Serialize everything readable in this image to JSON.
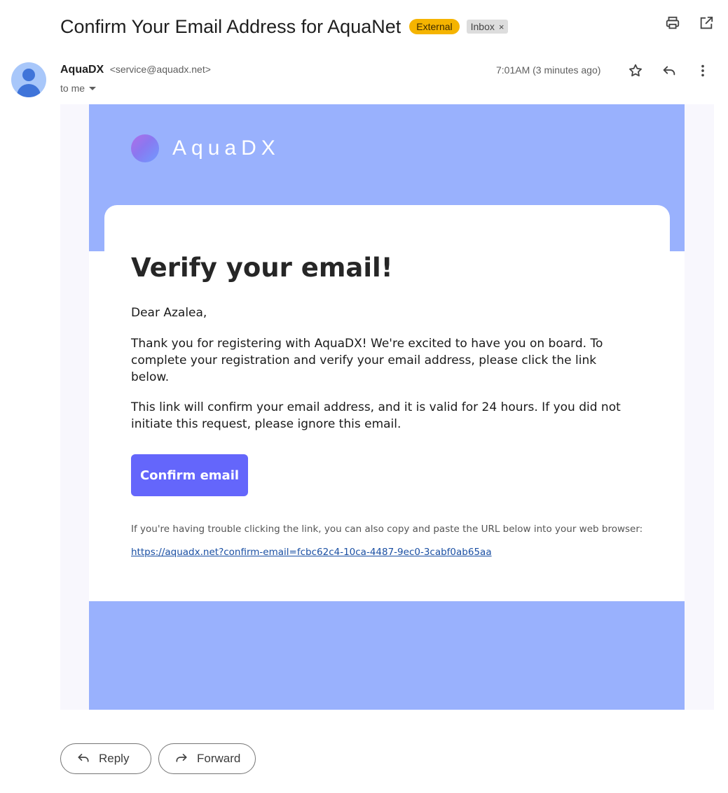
{
  "header": {
    "subject": "Confirm Your Email Address for AquaNet",
    "external_label": "External",
    "inbox_label": "Inbox",
    "inbox_remove": "×"
  },
  "message": {
    "sender_name": "AquaDX",
    "sender_email": "<service@aquadx.net>",
    "to": "to me",
    "time": "7:01AM (3 minutes ago)"
  },
  "email": {
    "logo_text": "AquaDX",
    "title": "Verify your email!",
    "greeting": "Dear Azalea,",
    "paragraph1": "Thank you for registering with AquaDX! We're excited to have you on board. To complete your registration and verify your email address, please click the link below.",
    "paragraph2": "This link will confirm your email address, and it is valid for 24 hours. If you did not initiate this request, please ignore this email.",
    "button_label": "Confirm email",
    "trouble_text": "If you're having trouble clicking the link, you can also copy and paste the URL below into your web browser:",
    "url": "https://aquadx.net?confirm-email=fcbc62c4-10ca-4487-9ec0-3cabf0ab65aa"
  },
  "actions": {
    "reply_label": "Reply",
    "forward_label": "Forward"
  },
  "colors": {
    "banner": "#99b1fd",
    "button": "#6466fb",
    "external_badge": "#f5b400"
  }
}
